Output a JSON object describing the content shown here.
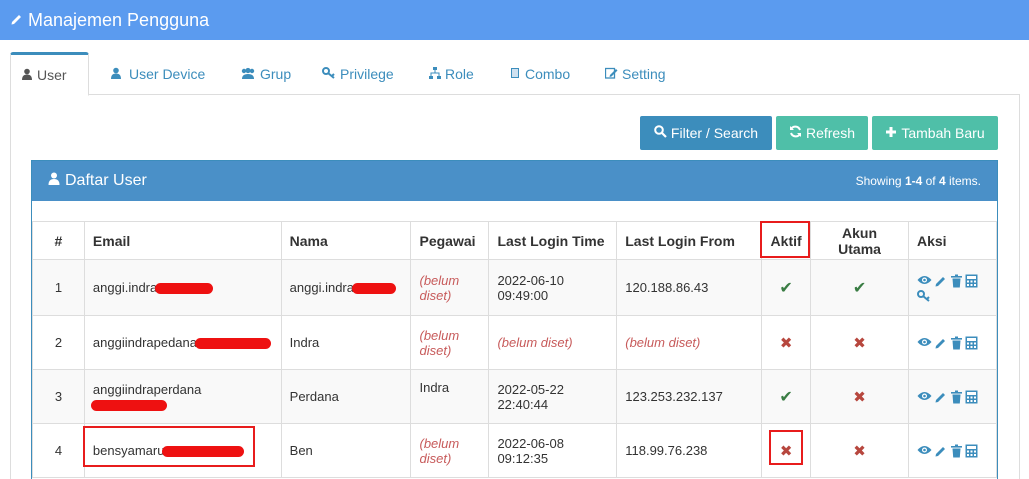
{
  "header": {
    "title": "Manajemen Pengguna"
  },
  "tabs": [
    {
      "label": "User",
      "icon": "user-icon"
    },
    {
      "label": "User Device",
      "icon": "user-icon"
    },
    {
      "label": "Grup",
      "icon": "users-icon"
    },
    {
      "label": "Privilege",
      "icon": "key-icon"
    },
    {
      "label": "Role",
      "icon": "sitemap-icon"
    },
    {
      "label": "Combo",
      "icon": "book-icon"
    },
    {
      "label": "Setting",
      "icon": "edit-icon"
    }
  ],
  "toolbar": {
    "filter_label": "Filter / Search",
    "refresh_label": "Refresh",
    "add_label": "Tambah Baru"
  },
  "panel": {
    "title": "Daftar User",
    "summary_prefix": "Showing ",
    "summary_range": "1-4",
    "summary_mid": " of ",
    "summary_total": "4",
    "summary_suffix": " items."
  },
  "table": {
    "headers": [
      "#",
      "Email",
      "Nama",
      "Pegawai",
      "Last Login Time",
      "Last Login From",
      "Aktif",
      "Akun Utama",
      "Aksi"
    ],
    "rows": [
      {
        "num": "1",
        "email": "anggi.indra",
        "nama": "anggi.indra",
        "pegawai": "(belum diset)",
        "llt_date": "2022-06-10",
        "llt_time": "09:49:00",
        "llf": "120.188.86.43",
        "aktif": "✔",
        "akun": "✔"
      },
      {
        "num": "2",
        "email": "anggiindrapedana",
        "nama": "Indra",
        "pegawai": "(belum diset)",
        "llt": "(belum diset)",
        "llf": "(belum diset)",
        "aktif": "✖",
        "akun": "✖"
      },
      {
        "num": "3",
        "email": "anggiindraperdana",
        "nama": "Perdana",
        "pegawai": "Indra",
        "llt_date": "2022-05-22",
        "llt_time": "22:40:44",
        "llf": "123.253.232.137",
        "aktif": "✔",
        "akun": "✖"
      },
      {
        "num": "4",
        "email": "bensyamaru",
        "nama": "Ben",
        "pegawai": "(belum diset)",
        "llt_date": "2022-06-08",
        "llt_time": "09:12:35",
        "llf": "118.99.76.238",
        "aktif": "✖",
        "akun": "✖"
      }
    ]
  },
  "colors": {
    "accent": "#3c8dbc",
    "topbar": "#5b9bef",
    "success": "#4fbfa8",
    "highlight": "#e81c1c"
  }
}
